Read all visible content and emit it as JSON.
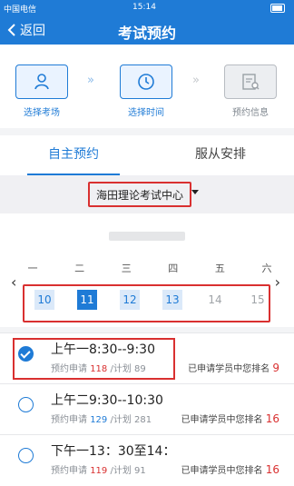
{
  "status_bar": {
    "carrier": "中国电信",
    "time": "15:14"
  },
  "nav": {
    "back_label": "返回",
    "title": "考试预约"
  },
  "steps": [
    {
      "label": "选择考场",
      "icon": "user-icon",
      "state": "active"
    },
    {
      "label": "选择时间",
      "icon": "clock-icon",
      "state": "active"
    },
    {
      "label": "预约信息",
      "icon": "document-search-icon",
      "state": "inactive"
    }
  ],
  "tabs": [
    {
      "label": "自主预约",
      "active": true
    },
    {
      "label": "服从安排",
      "active": false
    }
  ],
  "exam_center": "海田理论考试中心",
  "calendar": {
    "weekdays": [
      "一",
      "二",
      "三",
      "四",
      "五",
      "六"
    ],
    "days": [
      {
        "label": "10",
        "state": "available"
      },
      {
        "label": "11",
        "state": "selected"
      },
      {
        "label": "12",
        "state": "available"
      },
      {
        "label": "13",
        "state": "available"
      },
      {
        "label": "14",
        "state": "unavailable"
      },
      {
        "label": "15",
        "state": "unavailable"
      }
    ]
  },
  "slots": [
    {
      "time": "上午一8:30--9:30",
      "applied_label": "预约申请 ",
      "applied": "118",
      "plan_label": " /计划 ",
      "plan": "89",
      "rank_label": "已申请学员中您排名 ",
      "rank": "9",
      "checked": true
    },
    {
      "time": "上午二9:30--10:30",
      "applied_label": "预约申请 ",
      "applied": "129",
      "plan_label": " /计划 ",
      "plan": "281",
      "rank_label": "已申请学员中您排名 ",
      "rank": "16",
      "checked": false
    },
    {
      "time": "下午一13：30至14：",
      "applied_label": "预约申请 ",
      "applied": "119",
      "plan_label": " /计划 ",
      "plan": "91",
      "rank_label": "已申请学员中您排名 ",
      "rank": "16",
      "checked": false
    }
  ],
  "colors": {
    "primary": "#1f7bd6",
    "highlight": "#d93030"
  }
}
